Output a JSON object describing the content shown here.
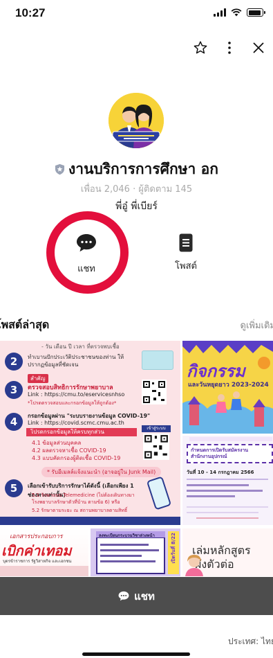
{
  "status_bar": {
    "time": "10:27"
  },
  "profile": {
    "name": "งานบริการการศึกษา อก",
    "stats": "เพื่อน 2,046 · ผู้ติดตาม 145",
    "status_message": "พี่อู๋ พี่เบียร์"
  },
  "actions": {
    "chat_label": "แชท",
    "post_label": "โพสต์"
  },
  "posts": {
    "title": "โพสต์ล่าสุด",
    "more": "ดูเพิ่มเติม",
    "tile_a": {
      "top_note": "- วัน เดือน ปี เวลา ที่ตรวจพบเชื้อ",
      "step2": "ทำเบานปักประเวัติประชาชนของท่าน ให้ปรากฏข้อมูลที่ชัดเจน",
      "step3_tag": "สำคัญ",
      "step3_title": "ตรวจสอบสิทธิการรักษาพยาบาล",
      "step3_link": "Link : https://cmu.to/eservicesnhso",
      "step3_note": "*โปรดตรวจสอบและกรอกข้อมูลให้ถูกต้อง*",
      "step4_title": "กรอกข้อมูลผ่าน \"ระบบรายงานข้อมูล COVID-19\"",
      "step4_link": "Link : https://covid.scmc.cmu.ac.th",
      "step4_bar": "โปรดกรอกข้อมูลให้ครบทุกส่วน",
      "step4_items": [
        "4.1 ข้อมูลส่วนบุคคล",
        "4.2 ผลตรวจหาเชื้อ COVID-19",
        "4.3 แบบคัดกรองผู้ติดเชื้อ COVID-19"
      ],
      "step4_qr_label": "เข้าสู่ระบบ",
      "step4_footer": "* รับอีเมลล์แจ้งแนะนำ (อาจอยู่ใน Junk Mail)",
      "step5_title": "เลือกเข้ารับบริการรักษาได้ดังนี้ (เลือกเพียง 1 ช่องทางเท่านั้น)",
      "step5_items": [
        "5.1 รักษาแบบ Telemedicine (ไม่ต้องเดินทางมาโรงพยาบาลรักษาตัวที่บ้าน ตามข้อ 6) หรือ",
        "5.2 รักษาตามระยะ ณ สถานพยาบาลตามสิทธิ์"
      ]
    },
    "tile_b": {
      "headline": "กิจกรรม",
      "sub": "และวันหยุดยาว 2023-2024"
    },
    "tile_c": {
      "banner": "กำหนดการเปิดรับสมัครงาน สำนักงานอุปกรณ์",
      "line": "วันที่ 10 - 14 กรกฎาคม 2566"
    },
    "tile_d": {
      "line1": "เอกสารประกอบการ",
      "headline": "เบิกค่าเทอม",
      "line2": "บุตรข้าราชการ รัฐวิสาหกิจ และเอกชน"
    },
    "tile_e": {
      "title": "ลงทะเบียนกระบวนวิชาล่วงหน้า",
      "side": "เปิดวันที่ 8/22"
    },
    "tile_f": {
      "headline": "เล่มหลักสูตร",
      "sub": "ผังตัวต่อ"
    }
  },
  "chat_bar": {
    "label": "แชท"
  },
  "footer": {
    "country": "ประเทศ: ไทย"
  },
  "colors": {
    "ring": "#e30f3c",
    "chat_bar": "#4d4d4d",
    "avatar_bg": "#f7d338"
  }
}
